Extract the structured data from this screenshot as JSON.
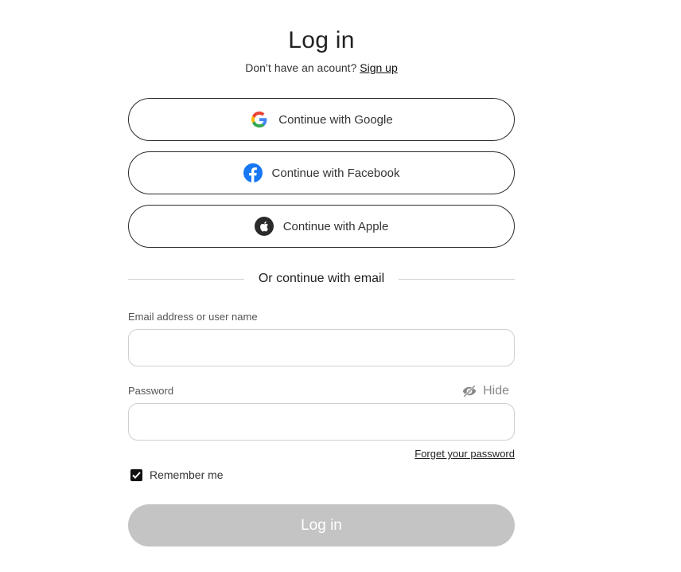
{
  "header": {
    "title": "Log in",
    "subtitle_text": "Don’t have an acount?",
    "signup_link": "Sign up"
  },
  "social": {
    "google_label": "Continue with Google",
    "facebook_label": "Continue with Facebook",
    "apple_label": "Continue with Apple"
  },
  "divider": {
    "text": "Or continue with email"
  },
  "form": {
    "email_label": "Email address or user name",
    "email_value": "",
    "password_label": "Password",
    "password_value": "",
    "hide_label": "Hide",
    "forgot_label": "Forget your password",
    "remember_label": "Remember me",
    "remember_checked": true,
    "login_label": "Log in"
  },
  "colors": {
    "facebook": "#1877F2",
    "login_disabled_bg": "#C4C4C4",
    "border": "#2B2B2B",
    "input_border": "#CFCFCF"
  },
  "icons": [
    "google-icon",
    "facebook-icon",
    "apple-icon",
    "eye-slash-icon",
    "checkmark-icon"
  ]
}
